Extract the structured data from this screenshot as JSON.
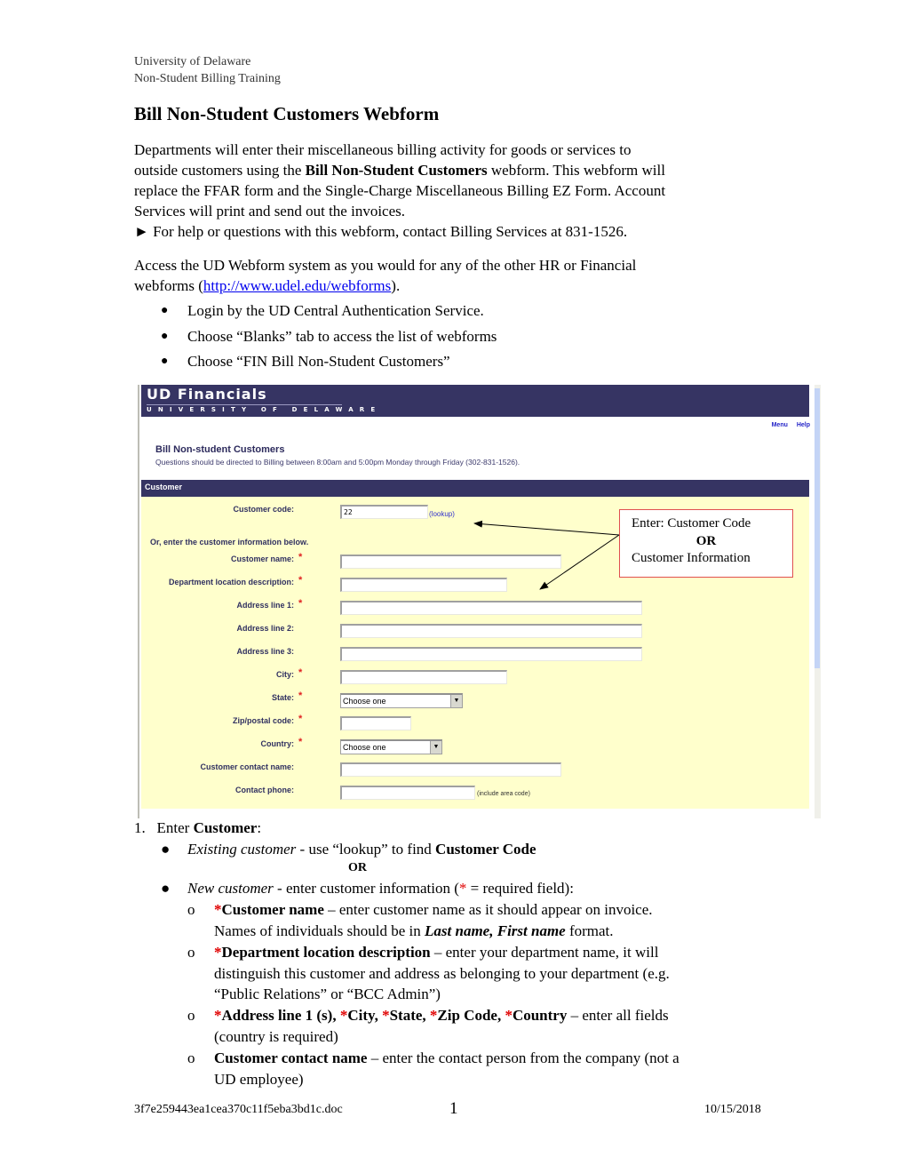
{
  "header": {
    "line1": "University of Delaware",
    "line2": "Non-Student Billing Training"
  },
  "title": "Bill Non-Student Customers Webform",
  "intro": {
    "l1": "Departments will enter their miscellaneous billing activity for goods or services to",
    "l2_pre": "outside customers using the ",
    "l2_bold": "Bill Non-Student Customers",
    "l2_post": " webform.  This webform will",
    "l3": "replace the FFAR form and the Single-Charge Miscellaneous Billing EZ Form.  Account",
    "l4": "Services will print and send out the invoices.",
    "l5": "► For help or questions with this webform, contact Billing Services at 831-1526."
  },
  "access": {
    "l1": "Access the UD Webform system as you would for any of the other HR or Financial",
    "l2_pre": "webforms (",
    "link": "http://www.udel.edu/webforms",
    "l2_post": ").",
    "bullets": [
      "Login by the UD Central Authentication Service.",
      "Choose “Blanks” tab to access the list of webforms",
      "Choose “FIN Bill Non-Student Customers”"
    ]
  },
  "screenshot": {
    "brand": "UD Financials",
    "brand_sub": "UNIVERSITY OF DELAWARE",
    "top_links": [
      "Menu",
      "Help"
    ],
    "form_title": "Bill Non-student Customers",
    "form_subtitle": "Questions should be directed to Billing between 8:00am and 5:00pm Monday through Friday (302-831-1526).",
    "section": "Customer",
    "customer_code_label": "Customer code:",
    "customer_code_value": "22",
    "lookup": "(lookup)",
    "or_enter": "Or, enter the customer information below.",
    "fields": {
      "customer_name": "Customer name:",
      "dept_location": "Department location description:",
      "address1": "Address line 1:",
      "address2": "Address line 2:",
      "address3": "Address line 3:",
      "city": "City:",
      "state": "State:",
      "zip": "Zip/postal code:",
      "country": "Country:",
      "contact_name": "Customer contact name:",
      "contact_phone": "Contact phone:"
    },
    "required_mark": "*",
    "state_selected": "Choose one",
    "country_selected": "Choose one",
    "phone_hint": "(include area code)"
  },
  "callout": {
    "l1": "Enter: Customer Code",
    "or": "OR",
    "l2": "Customer Information"
  },
  "steps": {
    "num": "1.",
    "enter": "Enter ",
    "customer": "Customer",
    "colon": ":",
    "existing_italic": "Existing customer",
    "existing_rest": " - use “lookup” to find ",
    "existing_bold": "Customer Code",
    "or": "OR",
    "new_italic": "New customer",
    "new_rest_pre": " - enter customer information (",
    "star": "*",
    "new_rest_post": " = required field):",
    "sub1_bold": "Customer name",
    "sub1_rest": " – enter customer name as it should appear on invoice.",
    "sub1_l2_pre": "Names of individuals should be in ",
    "sub1_l2_bi": "Last name, First name",
    "sub1_l2_post": " format.",
    "sub2_bold": "Department location description",
    "sub2_rest": " – enter your department name, it will",
    "sub2_l2": "distinguish this customer and address as belonging to your department (e.g.",
    "sub2_l3": "“Public Relations” or “BCC Admin”)",
    "sub3_a": "Address line 1 (s), ",
    "sub3_b": "City, ",
    "sub3_c": "State, ",
    "sub3_d": "Zip Code, ",
    "sub3_e": "Country",
    "sub3_rest": " – enter all fields",
    "sub3_l2": "(country is required)",
    "sub4_bold": "Customer contact name",
    "sub4_rest": " – enter the contact person from the company (not a",
    "sub4_l2": "UD employee)"
  },
  "footer": {
    "filename": "3f7e259443ea1cea370c11f5eba3bd1c.doc",
    "page": "1",
    "date": "10/15/2018"
  }
}
